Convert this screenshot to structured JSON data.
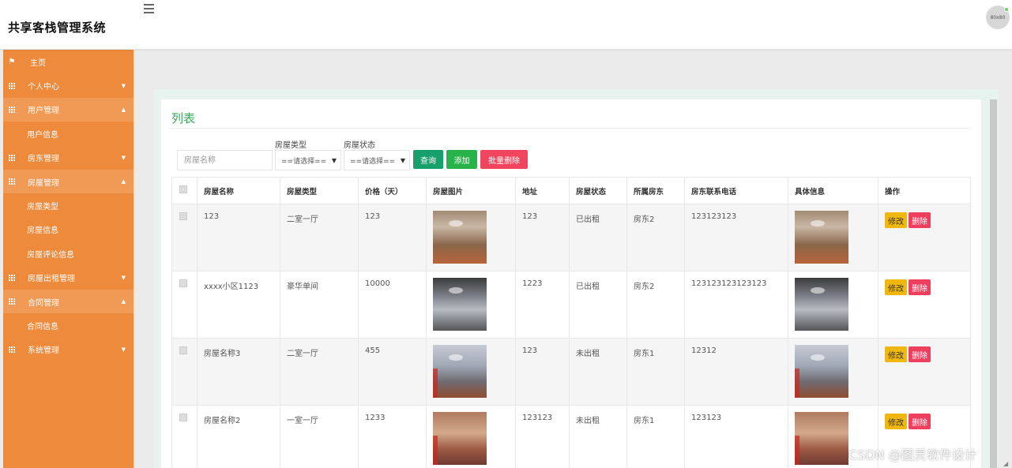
{
  "header": {
    "app_title": "共享客栈管理系统",
    "avatar_text": "80x80"
  },
  "sidebar": {
    "items": [
      {
        "label": "主页",
        "icon": "flag-icon",
        "arrow": ""
      },
      {
        "label": "个人中心",
        "icon": "grid-icon",
        "arrow": "▼"
      },
      {
        "label": "用户管理",
        "icon": "grid-icon",
        "arrow": "▲",
        "open": true
      },
      {
        "label": "用户信息",
        "sub": true
      },
      {
        "label": "房东管理",
        "icon": "grid-icon",
        "arrow": "▼"
      },
      {
        "label": "房屋管理",
        "icon": "grid-icon",
        "arrow": "▲",
        "open": true
      },
      {
        "label": "房屋类型",
        "sub": true
      },
      {
        "label": "房屋信息",
        "sub": true
      },
      {
        "label": "房屋评论信息",
        "sub": true
      },
      {
        "label": "房屋出租管理",
        "icon": "grid-icon",
        "arrow": "▼"
      },
      {
        "label": "合同管理",
        "icon": "grid-icon",
        "arrow": "▲",
        "open": true
      },
      {
        "label": "合同信息",
        "sub": true
      },
      {
        "label": "系统管理",
        "icon": "grid-icon",
        "arrow": "▼"
      }
    ]
  },
  "main": {
    "title": "列表",
    "search": {
      "placeholder": "房屋名称"
    },
    "filters": [
      {
        "label": "房屋类型",
        "value": "==请选择=="
      },
      {
        "label": "房屋状态",
        "value": "==请选择=="
      }
    ],
    "buttons": {
      "query": "查询",
      "add": "添加",
      "batch_delete": "批量删除"
    },
    "colors": {
      "query": "#17a06a",
      "add": "#28b34a",
      "batch_delete": "#f0445f",
      "title": "#3aa757",
      "sidebar": "#ee8a3c"
    },
    "table": {
      "headers": [
        "房屋名称",
        "房屋类型",
        "价格（天）",
        "房屋图片",
        "地址",
        "房屋状态",
        "所属房东",
        "房东联系电话",
        "具体信息",
        "操作"
      ],
      "rows": [
        {
          "name": "123",
          "type": "二室一厅",
          "price": "123",
          "address": "123",
          "status": "已出租",
          "landlord": "房东2",
          "phone": "123123123"
        },
        {
          "name": "xxxx小区1123",
          "type": "豪华单间",
          "price": "10000",
          "address": "1223",
          "status": "已出租",
          "landlord": "房东2",
          "phone": "123123123123123"
        },
        {
          "name": "房屋名称3",
          "type": "二室一厅",
          "price": "455",
          "address": "123",
          "status": "未出租",
          "landlord": "房东1",
          "phone": "12312"
        },
        {
          "name": "房屋名称2",
          "type": "一室一厅",
          "price": "1233",
          "address": "123123",
          "status": "未出租",
          "landlord": "房东1",
          "phone": "123123"
        }
      ],
      "row_actions": {
        "edit": "修改",
        "delete": "删除"
      }
    }
  },
  "watermark": "CSDN @图灵软件设计"
}
